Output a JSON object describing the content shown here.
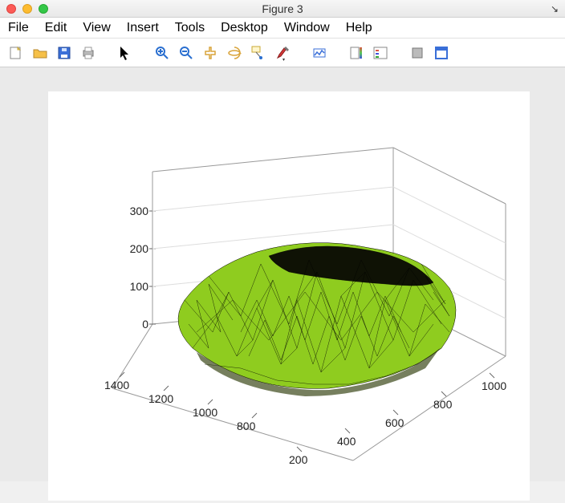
{
  "window": {
    "title": "Figure 3"
  },
  "menubar": {
    "items": [
      "File",
      "Edit",
      "View",
      "Insert",
      "Tools",
      "Desktop",
      "Window",
      "Help"
    ]
  },
  "toolbar": {
    "icons": [
      "new-figure-icon",
      "open-file-icon",
      "save-icon",
      "print-icon",
      "pointer-icon",
      "zoom-in-icon",
      "zoom-out-icon",
      "pan-icon",
      "rotate3d-icon",
      "data-cursor-icon",
      "brush-icon",
      "link-plot-icon",
      "colorbar-icon",
      "legend-icon",
      "hide-plot-tools-icon",
      "dock-figure-icon"
    ]
  },
  "chart_data": {
    "type": "3d-surface-mesh",
    "title": "",
    "xlabel": "",
    "ylabel": "",
    "zlabel": "",
    "x_range": [
      800,
      1400
    ],
    "y_range": [
      200,
      1000
    ],
    "z_range": [
      0,
      300
    ],
    "x_ticks": [
      800,
      1000,
      1200,
      1400
    ],
    "y_ticks": [
      200,
      400,
      600,
      800,
      1000
    ],
    "z_ticks": [
      0,
      100,
      200,
      300
    ],
    "face_color": "#8fcc1f",
    "edge_color": "#000000",
    "description": "Dense triangulated mesh surface, roughly oval footprint, dome-like with flat dark top."
  }
}
